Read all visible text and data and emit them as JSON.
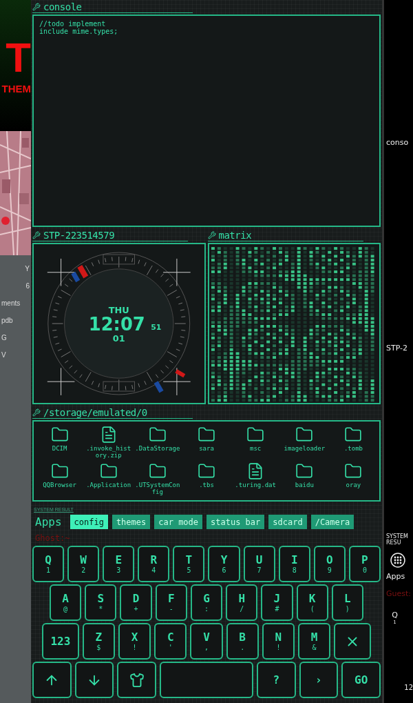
{
  "left_edge": {
    "headline": "T",
    "subline": "THEM",
    "labels": [
      "ments",
      "pdb"
    ],
    "letters": [
      "Y",
      "6",
      "G",
      "V"
    ]
  },
  "console": {
    "title": "console",
    "lines": [
      "//todo implement",
      "include mime.types;"
    ]
  },
  "clock_widget": {
    "title": "STP-223514579",
    "day": "THU",
    "time": "12:07",
    "seconds": "51",
    "date": "01"
  },
  "matrix": {
    "title": "matrix"
  },
  "files": {
    "path": "/storage/emulated/0",
    "items": [
      {
        "name": "DCIM",
        "kind": "folder"
      },
      {
        "name": ".invoke_history.zip",
        "kind": "file"
      },
      {
        "name": ".DataStorage",
        "kind": "folder"
      },
      {
        "name": "sara",
        "kind": "folder"
      },
      {
        "name": "msc",
        "kind": "folder"
      },
      {
        "name": "imageloader",
        "kind": "folder"
      },
      {
        "name": ".tomb",
        "kind": "folder"
      },
      {
        "name": "QQBrowser",
        "kind": "folder"
      },
      {
        "name": ".Application",
        "kind": "folder"
      },
      {
        "name": ".UTSystemConfig",
        "kind": "folder"
      },
      {
        "name": ".tbs",
        "kind": "folder"
      },
      {
        "name": ".turing.dat",
        "kind": "file"
      },
      {
        "name": "baidu",
        "kind": "folder"
      },
      {
        "name": "oray",
        "kind": "folder"
      }
    ]
  },
  "status_line": "SYSTEM RESULT",
  "apps_bar": {
    "label": "Apps",
    "chips": [
      {
        "label": "config",
        "selected": true
      },
      {
        "label": "themes",
        "selected": false
      },
      {
        "label": "car mode",
        "selected": false
      },
      {
        "label": "status bar",
        "selected": false
      },
      {
        "label": "sdcard",
        "selected": false
      },
      {
        "label": "/Camera",
        "selected": false
      }
    ]
  },
  "prompt": "Ghost:~",
  "keyboard": [
    [
      {
        "kind": "char",
        "main": "Q",
        "sub": "1"
      },
      {
        "kind": "char",
        "main": "W",
        "sub": "2"
      },
      {
        "kind": "char",
        "main": "E",
        "sub": "3"
      },
      {
        "kind": "char",
        "main": "R",
        "sub": "4"
      },
      {
        "kind": "char",
        "main": "T",
        "sub": "5"
      },
      {
        "kind": "char",
        "main": "Y",
        "sub": "6"
      },
      {
        "kind": "char",
        "main": "U",
        "sub": "7"
      },
      {
        "kind": "char",
        "main": "I",
        "sub": "8"
      },
      {
        "kind": "char",
        "main": "O",
        "sub": "9"
      },
      {
        "kind": "char",
        "main": "P",
        "sub": "0"
      }
    ],
    [
      {
        "kind": "char",
        "main": "A",
        "sub": "@"
      },
      {
        "kind": "char",
        "main": "S",
        "sub": "*"
      },
      {
        "kind": "char",
        "main": "D",
        "sub": "+"
      },
      {
        "kind": "char",
        "main": "F",
        "sub": "-"
      },
      {
        "kind": "char",
        "main": "G",
        "sub": ":"
      },
      {
        "kind": "char",
        "main": "H",
        "sub": "/"
      },
      {
        "kind": "char",
        "main": "J",
        "sub": "#"
      },
      {
        "kind": "char",
        "main": "K",
        "sub": "("
      },
      {
        "kind": "char",
        "main": "L",
        "sub": ")"
      }
    ],
    [
      {
        "kind": "text",
        "main": "123"
      },
      {
        "kind": "char",
        "main": "Z",
        "sub": "$"
      },
      {
        "kind": "char",
        "main": "X",
        "sub": "!"
      },
      {
        "kind": "char",
        "main": "C",
        "sub": "'"
      },
      {
        "kind": "char",
        "main": "V",
        "sub": ","
      },
      {
        "kind": "char",
        "main": "B",
        "sub": "."
      },
      {
        "kind": "char",
        "main": "N",
        "sub": "!"
      },
      {
        "kind": "char",
        "main": "M",
        "sub": "&"
      },
      {
        "kind": "delete"
      }
    ],
    [
      {
        "kind": "up"
      },
      {
        "kind": "down"
      },
      {
        "kind": "theme"
      },
      {
        "kind": "space"
      },
      {
        "kind": "text",
        "main": "?"
      },
      {
        "kind": "text",
        "main": "›"
      },
      {
        "kind": "text",
        "main": "GO"
      }
    ]
  ],
  "right_edge": {
    "console_title": "conso",
    "widget_title": "STP-2",
    "status_line": "SYSTEM RESU",
    "apps_label": "Apps",
    "prompt": "Guest:",
    "key_main": "Q",
    "key_sub": "1",
    "clock": "12"
  }
}
